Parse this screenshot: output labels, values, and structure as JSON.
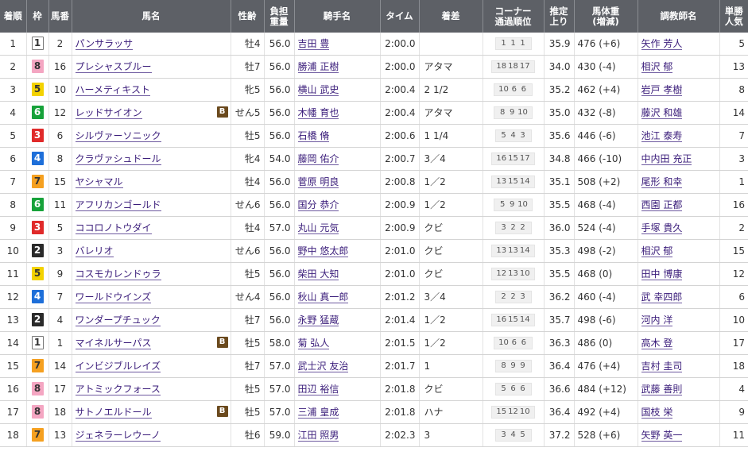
{
  "headers": {
    "rank": "着順",
    "frame": "枠",
    "num": "馬番",
    "horse": "馬名",
    "sexage": "性齢",
    "weight_l1": "負担",
    "weight_l2": "重量",
    "jockey": "騎手名",
    "time": "タイム",
    "margin": "着差",
    "corner_l1": "コーナー",
    "corner_l2": "通過順位",
    "last3f_l1": "推定",
    "last3f_l2": "上り",
    "bodyweight_l1": "馬体重",
    "bodyweight_l2": "(増減)",
    "trainer": "調教師名",
    "pop_l1": "単勝",
    "pop_l2": "人気"
  },
  "blinker_label": "B",
  "rows": [
    {
      "rank": "1",
      "frame": "1",
      "num": "2",
      "horse": "パンサラッサ",
      "blinker": false,
      "sexage": "牡4",
      "weight": "56.0",
      "jockey": "吉田 豊",
      "time": "2:00.0",
      "margin": "",
      "corner": [
        "1",
        "1",
        "1"
      ],
      "last3f": "35.9",
      "bodyweight": "476 (+6)",
      "trainer": "矢作 芳人",
      "pop": "5"
    },
    {
      "rank": "2",
      "frame": "8",
      "num": "16",
      "horse": "プレシャスブルー",
      "blinker": false,
      "sexage": "牡7",
      "weight": "56.0",
      "jockey": "勝浦 正樹",
      "time": "2:00.0",
      "margin": "アタマ",
      "corner": [
        "18",
        "18",
        "17"
      ],
      "last3f": "34.0",
      "bodyweight": "430 (-4)",
      "trainer": "相沢 郁",
      "pop": "13"
    },
    {
      "rank": "3",
      "frame": "5",
      "num": "10",
      "horse": "ハーメティキスト",
      "blinker": false,
      "sexage": "牝5",
      "weight": "56.0",
      "jockey": "横山 武史",
      "time": "2:00.4",
      "margin": "2 1/2",
      "corner": [
        "10",
        "6",
        "6"
      ],
      "last3f": "35.2",
      "bodyweight": "462 (+4)",
      "trainer": "岩戸 孝樹",
      "pop": "8"
    },
    {
      "rank": "4",
      "frame": "6",
      "num": "12",
      "horse": "レッドサイオン",
      "blinker": true,
      "sexage": "せん5",
      "weight": "56.0",
      "jockey": "木幡 育也",
      "time": "2:00.4",
      "margin": "アタマ",
      "corner": [
        "8",
        "9",
        "10"
      ],
      "last3f": "35.0",
      "bodyweight": "432 (-8)",
      "trainer": "藤沢 和雄",
      "pop": "14"
    },
    {
      "rank": "5",
      "frame": "3",
      "num": "6",
      "horse": "シルヴァーソニック",
      "blinker": false,
      "sexage": "牡5",
      "weight": "56.0",
      "jockey": "石橋 脩",
      "time": "2:00.6",
      "margin": "1 1/4",
      "corner": [
        "5",
        "4",
        "3"
      ],
      "last3f": "35.6",
      "bodyweight": "446 (-6)",
      "trainer": "池江 泰寿",
      "pop": "7"
    },
    {
      "rank": "6",
      "frame": "4",
      "num": "8",
      "horse": "クラヴァシュドール",
      "blinker": false,
      "sexage": "牝4",
      "weight": "54.0",
      "jockey": "藤岡 佑介",
      "time": "2:00.7",
      "margin": "3／4",
      "corner": [
        "16",
        "15",
        "17"
      ],
      "last3f": "34.8",
      "bodyweight": "466 (-10)",
      "trainer": "中内田 充正",
      "pop": "3"
    },
    {
      "rank": "7",
      "frame": "7",
      "num": "15",
      "horse": "ヤシャマル",
      "blinker": false,
      "sexage": "牡4",
      "weight": "56.0",
      "jockey": "菅原 明良",
      "time": "2:00.8",
      "margin": "1／2",
      "corner": [
        "13",
        "15",
        "14"
      ],
      "last3f": "35.1",
      "bodyweight": "508 (+2)",
      "trainer": "尾形 和幸",
      "pop": "1"
    },
    {
      "rank": "8",
      "frame": "6",
      "num": "11",
      "horse": "アフリカンゴールド",
      "blinker": false,
      "sexage": "せん6",
      "weight": "56.0",
      "jockey": "国分 恭介",
      "time": "2:00.9",
      "margin": "1／2",
      "corner": [
        "5",
        "9",
        "10"
      ],
      "last3f": "35.5",
      "bodyweight": "468 (-4)",
      "trainer": "西園 正都",
      "pop": "16"
    },
    {
      "rank": "9",
      "frame": "3",
      "num": "5",
      "horse": "ココロノトウダイ",
      "blinker": false,
      "sexage": "牡4",
      "weight": "57.0",
      "jockey": "丸山 元気",
      "time": "2:00.9",
      "margin": "クビ",
      "corner": [
        "3",
        "2",
        "2"
      ],
      "last3f": "36.0",
      "bodyweight": "524 (-4)",
      "trainer": "手塚 貴久",
      "pop": "2"
    },
    {
      "rank": "10",
      "frame": "2",
      "num": "3",
      "horse": "バレリオ",
      "blinker": false,
      "sexage": "せん6",
      "weight": "56.0",
      "jockey": "野中 悠太郎",
      "time": "2:01.0",
      "margin": "クビ",
      "corner": [
        "13",
        "13",
        "14"
      ],
      "last3f": "35.3",
      "bodyweight": "498 (-2)",
      "trainer": "相沢 郁",
      "pop": "15"
    },
    {
      "rank": "11",
      "frame": "5",
      "num": "9",
      "horse": "コスモカレンドゥラ",
      "blinker": false,
      "sexage": "牡5",
      "weight": "56.0",
      "jockey": "柴田 大知",
      "time": "2:01.0",
      "margin": "クビ",
      "corner": [
        "12",
        "13",
        "10"
      ],
      "last3f": "35.5",
      "bodyweight": "468 (0)",
      "trainer": "田中 博康",
      "pop": "12"
    },
    {
      "rank": "12",
      "frame": "4",
      "num": "7",
      "horse": "ワールドウインズ",
      "blinker": false,
      "sexage": "せん4",
      "weight": "56.0",
      "jockey": "秋山 真一郎",
      "time": "2:01.2",
      "margin": "3／4",
      "corner": [
        "2",
        "2",
        "3"
      ],
      "last3f": "36.2",
      "bodyweight": "460 (-4)",
      "trainer": "武 幸四郎",
      "pop": "6"
    },
    {
      "rank": "13",
      "frame": "2",
      "num": "4",
      "horse": "ワンダープチュック",
      "blinker": false,
      "sexage": "牡7",
      "weight": "56.0",
      "jockey": "永野 猛蔵",
      "time": "2:01.4",
      "margin": "1／2",
      "corner": [
        "16",
        "15",
        "14"
      ],
      "last3f": "35.7",
      "bodyweight": "498 (-6)",
      "trainer": "河内 洋",
      "pop": "10"
    },
    {
      "rank": "14",
      "frame": "1",
      "num": "1",
      "horse": "マイネルサーパス",
      "blinker": true,
      "sexage": "牡5",
      "weight": "58.0",
      "jockey": "菊 弘人",
      "time": "2:01.5",
      "margin": "1／2",
      "corner": [
        "10",
        "6",
        "6"
      ],
      "last3f": "36.3",
      "bodyweight": "486 (0)",
      "trainer": "高木 登",
      "pop": "17"
    },
    {
      "rank": "15",
      "frame": "7",
      "num": "14",
      "horse": "インビジブルレイズ",
      "blinker": false,
      "sexage": "牡7",
      "weight": "57.0",
      "jockey": "武士沢 友治",
      "time": "2:01.7",
      "margin": "1",
      "corner": [
        "8",
        "9",
        "9"
      ],
      "last3f": "36.4",
      "bodyweight": "476 (+4)",
      "trainer": "吉村 圭司",
      "pop": "18"
    },
    {
      "rank": "16",
      "frame": "8",
      "num": "17",
      "horse": "アトミックフォース",
      "blinker": false,
      "sexage": "牡5",
      "weight": "57.0",
      "jockey": "田辺 裕信",
      "time": "2:01.8",
      "margin": "クビ",
      "corner": [
        "5",
        "6",
        "6"
      ],
      "last3f": "36.6",
      "bodyweight": "484 (+12)",
      "trainer": "武藤 善則",
      "pop": "4"
    },
    {
      "rank": "17",
      "frame": "8",
      "num": "18",
      "horse": "サトノエルドール",
      "blinker": true,
      "sexage": "牡5",
      "weight": "57.0",
      "jockey": "三浦 皇成",
      "time": "2:01.8",
      "margin": "ハナ",
      "corner": [
        "15",
        "12",
        "10"
      ],
      "last3f": "36.4",
      "bodyweight": "492 (+4)",
      "trainer": "国枝 栄",
      "pop": "9"
    },
    {
      "rank": "18",
      "frame": "7",
      "num": "13",
      "horse": "ジェネラーレウーノ",
      "blinker": false,
      "sexage": "牡6",
      "weight": "59.0",
      "jockey": "江田 照男",
      "time": "2:02.3",
      "margin": "3",
      "corner": [
        "3",
        "4",
        "5"
      ],
      "last3f": "37.2",
      "bodyweight": "528 (+6)",
      "trainer": "矢野 英一",
      "pop": "11"
    }
  ]
}
